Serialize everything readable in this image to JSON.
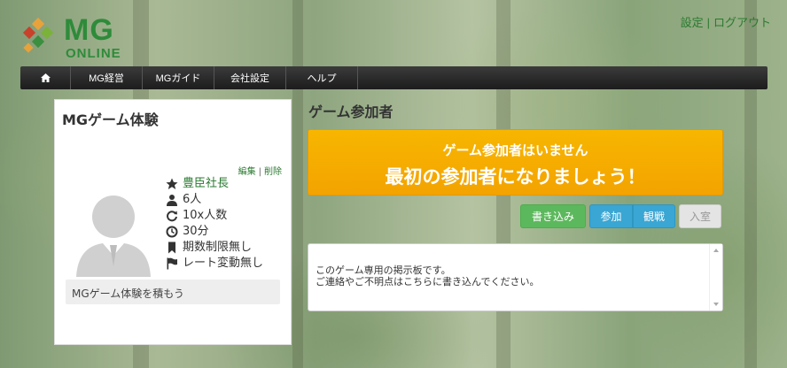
{
  "header": {
    "logo": {
      "mg": "MG",
      "online": "ONLINE"
    },
    "settings_link": "設定",
    "separator": "|",
    "logout_link": "ログアウト"
  },
  "nav": {
    "home_icon": "home-icon",
    "items": [
      "MG経営",
      "MGガイド",
      "会社設定",
      "ヘルプ"
    ]
  },
  "game": {
    "title": "MGゲーム体験",
    "edit_label": "編集",
    "edit_sep": "|",
    "delete_label": "削除",
    "owner": "豊臣社長",
    "players": "6人",
    "rounds": "10x人数",
    "time": "30分",
    "term_limit": "期数制限無し",
    "rate_change": "レート変動無し",
    "description": "MGゲーム体験を積もう"
  },
  "participants": {
    "section_title": "ゲーム参加者",
    "banner_line1": "ゲーム参加者はいません",
    "banner_line2": "最初の参加者になりましょう！"
  },
  "actions": {
    "post": "書き込み",
    "join": "参加",
    "watch": "観戦",
    "enter": "入室"
  },
  "board": {
    "line1": "このゲーム専用の掲示板です。",
    "line2": "ご連絡やご不明点はこちらに書き込んでください。"
  },
  "colors": {
    "brand_green": "#2e8b3a",
    "banner_orange": "#f4a300",
    "post_green": "#5cb85c",
    "action_blue": "#3aa6d3"
  }
}
